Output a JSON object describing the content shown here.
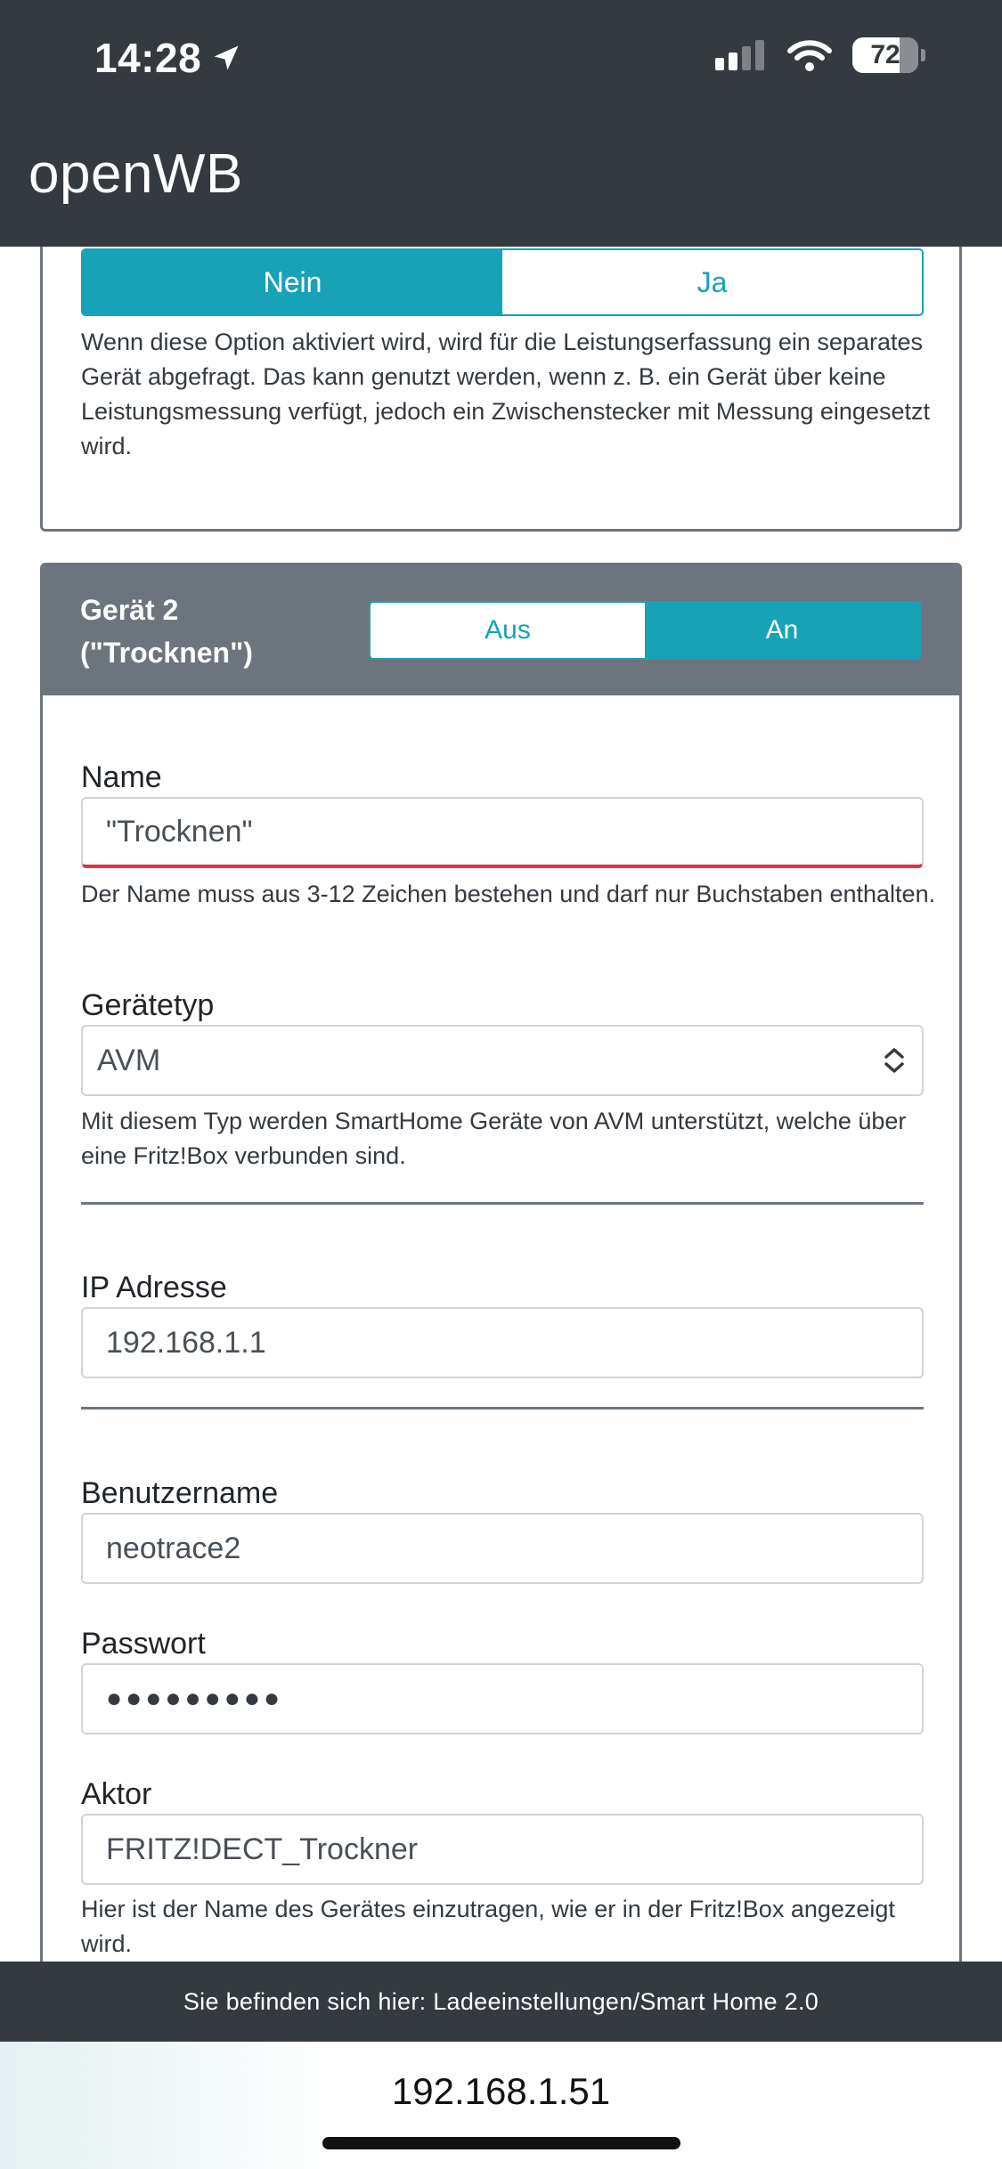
{
  "status_bar": {
    "time": "14:28",
    "battery": "72"
  },
  "app": {
    "brand": "openWB"
  },
  "prev_card": {
    "toggle": {
      "off_label": "Nein",
      "on_label": "Ja",
      "selected": "Nein"
    },
    "help": "Wenn diese Option aktiviert wird, wird für die Leistungserfassung ein separates Gerät abgefragt. Das kann genutzt werden, wenn z. B. ein Gerät über keine Leistungsmessung verfügt, jedoch ein Zwischenstecker mit Messung eingesetzt wird."
  },
  "device_card": {
    "title": "Gerät 2 (\"Trocknen\")",
    "toggle": {
      "off_label": "Aus",
      "on_label": "An",
      "selected": "An"
    },
    "name": {
      "label": "Name",
      "value": "\"Trocknen\"",
      "error": "Der Name muss aus 3-12 Zeichen bestehen und darf nur Buchstaben enthalten."
    },
    "type": {
      "label": "Gerätetyp",
      "value": "AVM",
      "help": "Mit diesem Typ werden SmartHome Geräte von AVM unterstützt, welche über eine Fritz!Box verbunden sind."
    },
    "ip": {
      "label": "IP Adresse",
      "value": "192.168.1.1"
    },
    "username": {
      "label": "Benutzername",
      "value": "neotrace2"
    },
    "password": {
      "label": "Passwort",
      "value": "●●●●●●●●●"
    },
    "actor": {
      "label": "Aktor",
      "value": "FRITZ!DECT_Trockner",
      "help": "Hier ist der Name des Gerätes einzutragen, wie er in der Fritz!Box angezeigt wird."
    }
  },
  "footer": {
    "breadcrumb": "Sie befinden sich hier: Ladeeinstellungen/Smart Home 2.0"
  },
  "browser": {
    "url": "192.168.1.51"
  },
  "colors": {
    "header": "#343a40",
    "accent": "#17a2b8",
    "card_header": "#6c757d",
    "error": "#dc3545"
  }
}
